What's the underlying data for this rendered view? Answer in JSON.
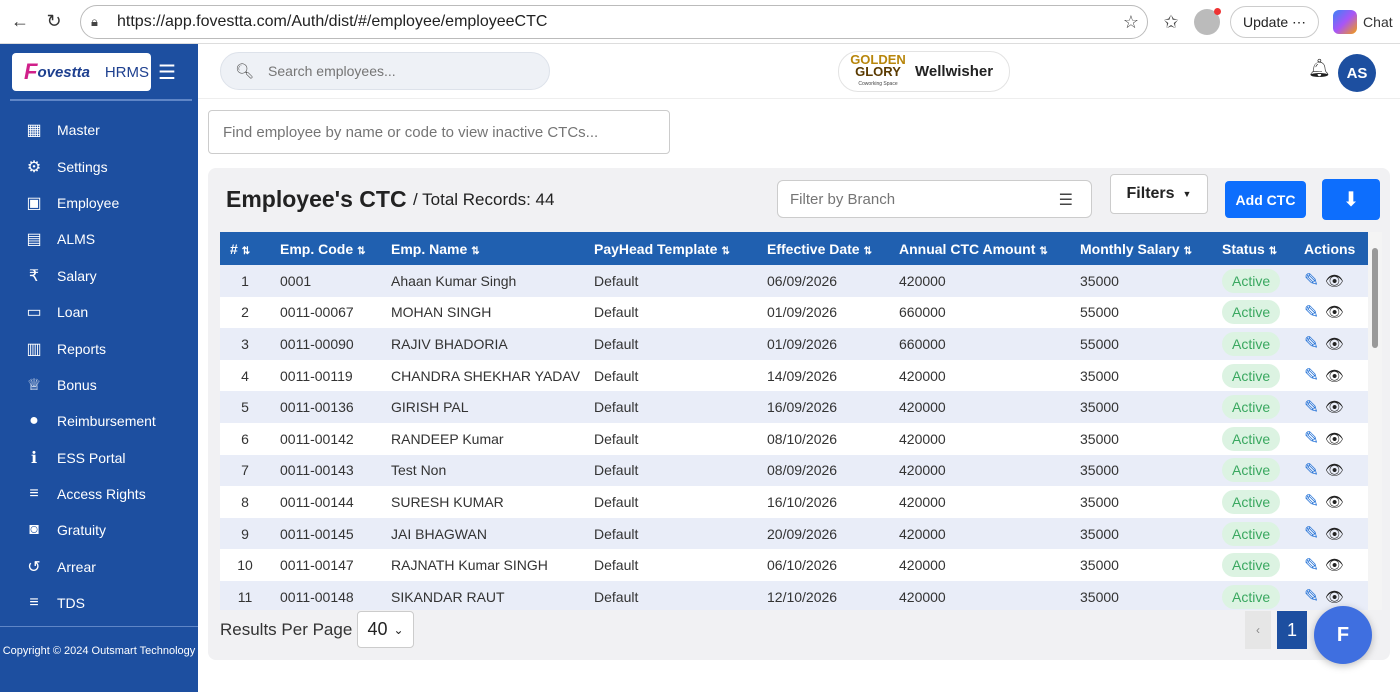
{
  "browser": {
    "url": "https://app.fovestta.com/Auth/dist/#/employee/employeeCTC",
    "update_label": "Update",
    "chat_label": "Chat"
  },
  "sidebar": {
    "logo_text": "ovestta",
    "logo_letter": "F",
    "logo_suffix": "HRMS",
    "items": [
      {
        "label": "Master",
        "icon": "grid-icon"
      },
      {
        "label": "Settings",
        "icon": "gear-icon"
      },
      {
        "label": "Employee",
        "icon": "id-badge-icon"
      },
      {
        "label": "ALMS",
        "icon": "calendar-icon"
      },
      {
        "label": "Salary",
        "icon": "rupee-icon"
      },
      {
        "label": "Loan",
        "icon": "wallet-icon"
      },
      {
        "label": "Reports",
        "icon": "chart-icon"
      },
      {
        "label": "Bonus",
        "icon": "trophy-icon"
      },
      {
        "label": "Reimbursement",
        "icon": "piggy-bank-icon"
      },
      {
        "label": "ESS Portal",
        "icon": "info-icon"
      },
      {
        "label": "Access Rights",
        "icon": "list-icon"
      },
      {
        "label": "Gratuity",
        "icon": "briefcase-icon"
      },
      {
        "label": "Arrear",
        "icon": "history-icon"
      },
      {
        "label": "TDS",
        "icon": "list-icon"
      }
    ],
    "copyright": "Copyright © 2024 Outsmart Technology"
  },
  "topbar": {
    "search_placeholder": "Search employees...",
    "org_logo_line1": "GOLDEN",
    "org_logo_line2": "GLORY",
    "org_logo_line3": "Coworking Space",
    "org_name": "Wellwisher",
    "user_initials": "AS"
  },
  "inactive_search": {
    "placeholder": "Find employee by name or code to view inactive CTCs..."
  },
  "panel": {
    "title": "Employee's CTC",
    "subtitle": "/ Total Records: 44",
    "branch_placeholder": "Filter by Branch",
    "filters_label": "Filters",
    "add_label": "Add CTC"
  },
  "table": {
    "columns": [
      "#",
      "Emp. Code",
      "Emp. Name",
      "PayHead Template",
      "Effective Date",
      "Annual CTC Amount",
      "Monthly Salary",
      "Status",
      "Actions"
    ],
    "rows": [
      [
        "1",
        "0001",
        "Ahaan Kumar Singh",
        "Default",
        "06/09/2026",
        "420000",
        "35000",
        "Active"
      ],
      [
        "2",
        "0011-00067",
        "MOHAN SINGH",
        "Default",
        "01/09/2026",
        "660000",
        "55000",
        "Active"
      ],
      [
        "3",
        "0011-00090",
        "RAJIV BHADORIA",
        "Default",
        "01/09/2026",
        "660000",
        "55000",
        "Active"
      ],
      [
        "4",
        "0011-00119",
        "CHANDRA SHEKHAR YADAV",
        "Default",
        "14/09/2026",
        "420000",
        "35000",
        "Active"
      ],
      [
        "5",
        "0011-00136",
        "GIRISH PAL",
        "Default",
        "16/09/2026",
        "420000",
        "35000",
        "Active"
      ],
      [
        "6",
        "0011-00142",
        "RANDEEP Kumar",
        "Default",
        "08/10/2026",
        "420000",
        "35000",
        "Active"
      ],
      [
        "7",
        "0011-00143",
        "Test Non",
        "Default",
        "08/09/2026",
        "420000",
        "35000",
        "Active"
      ],
      [
        "8",
        "0011-00144",
        "SURESH KUMAR",
        "Default",
        "16/10/2026",
        "420000",
        "35000",
        "Active"
      ],
      [
        "9",
        "0011-00145",
        "JAI BHAGWAN",
        "Default",
        "20/09/2026",
        "420000",
        "35000",
        "Active"
      ],
      [
        "10",
        "0011-00147",
        "RAJNATH Kumar SINGH",
        "Default",
        "06/10/2026",
        "420000",
        "35000",
        "Active"
      ],
      [
        "11",
        "0011-00148",
        "SIKANDAR RAUT",
        "Default",
        "12/10/2026",
        "420000",
        "35000",
        "Active"
      ]
    ]
  },
  "footer": {
    "results_per_page_label": "Results Per Page",
    "results_per_page_value": "40",
    "prev_label": "‹",
    "current_page": "1",
    "fab_label": "F"
  },
  "colors": {
    "sidebar": "#1d4fa0",
    "table_header": "#2060b0",
    "primary_button": "#0d6efd",
    "status_green": "#3aa860"
  }
}
